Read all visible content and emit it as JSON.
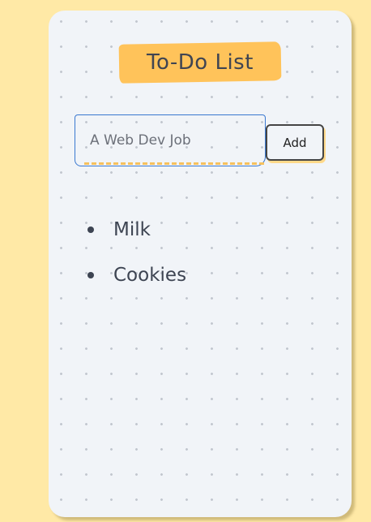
{
  "app": {
    "title": "To-Do List"
  },
  "input": {
    "value": "A Web Dev Job",
    "placeholder": ""
  },
  "add_button": {
    "label": "Add"
  },
  "todos": [
    {
      "text": "Milk"
    },
    {
      "text": "Cookies"
    }
  ],
  "colors": {
    "page_background": "#ffe9a6",
    "card_background": "#f1f4f8",
    "title_highlight": "#ffc35a",
    "input_border": "#3a78d0",
    "text": "#3d4452"
  }
}
